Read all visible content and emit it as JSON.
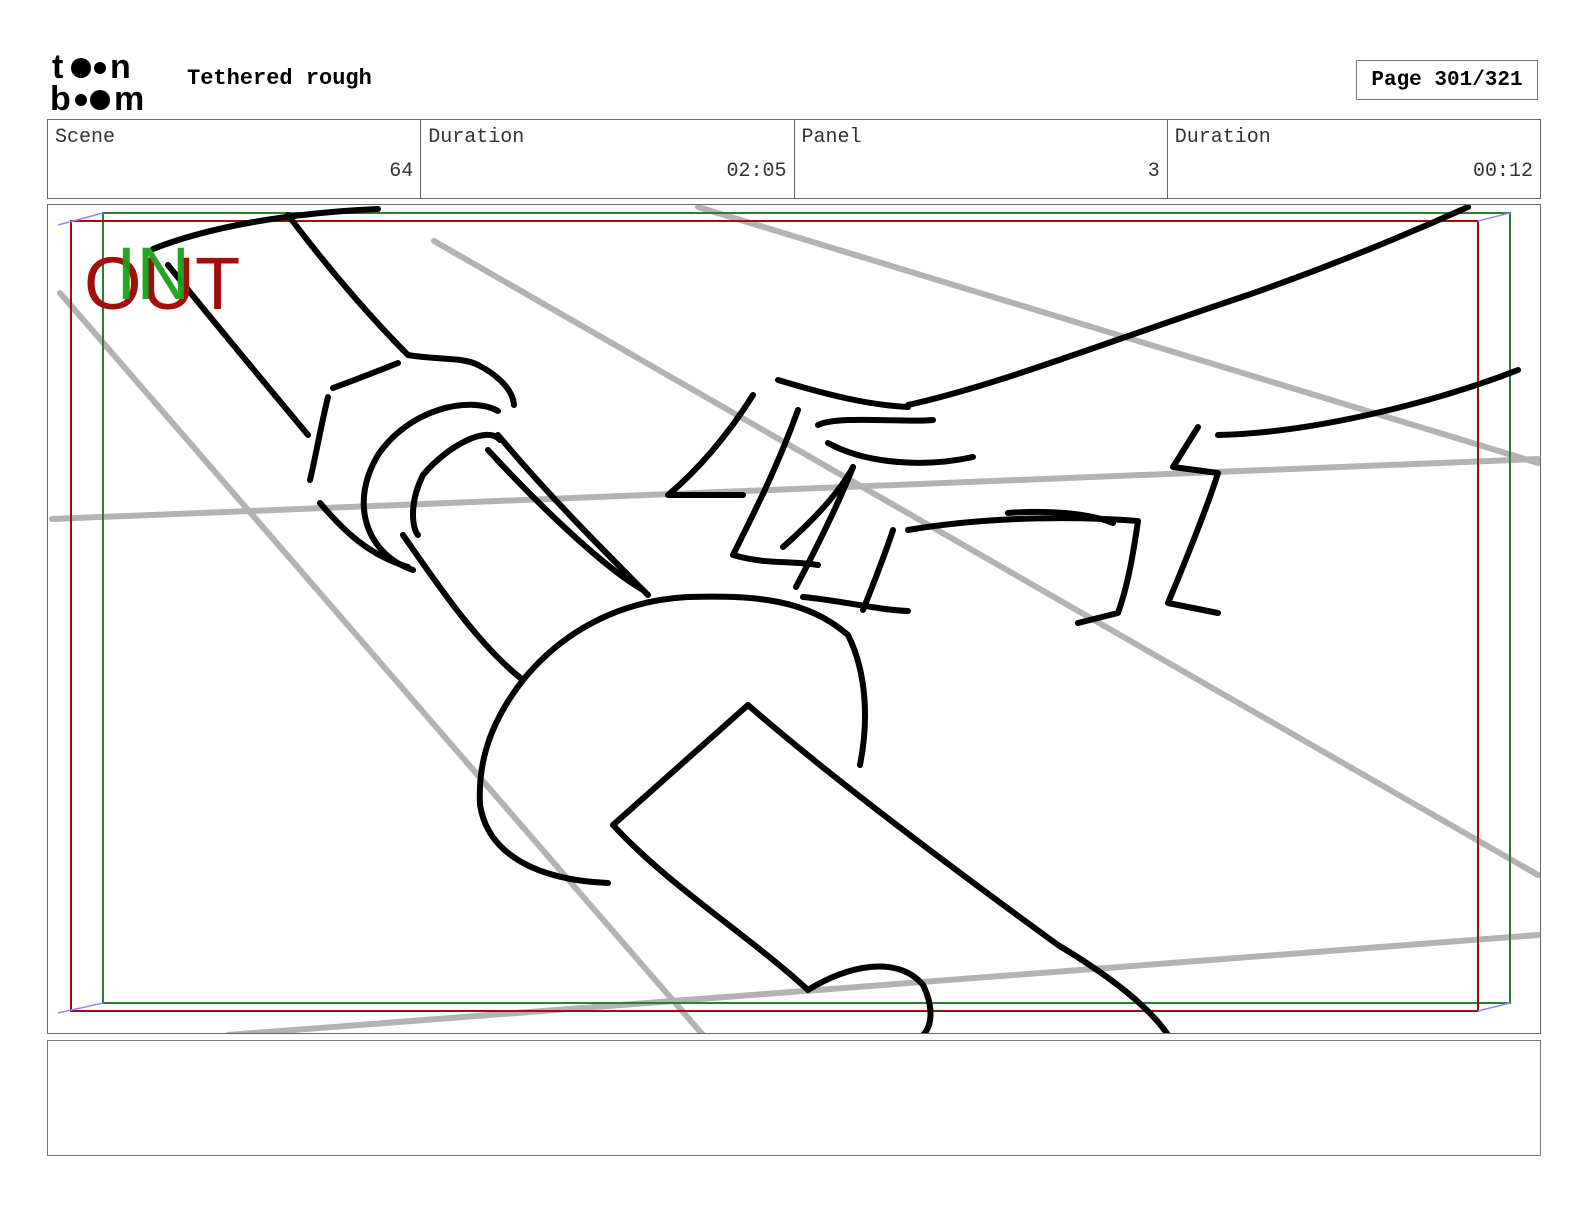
{
  "header": {
    "logo_text": "toon boom",
    "project_title": "Tethered rough",
    "page_label": "Page 301/321"
  },
  "info": {
    "scene_label": "Scene",
    "scene_value": "64",
    "scene_duration_label": "Duration",
    "scene_duration_value": "02:05",
    "panel_label": "Panel",
    "panel_value": "3",
    "panel_duration_label": "Duration",
    "panel_duration_value": "00:12"
  },
  "panel": {
    "in_label": "IN",
    "out_label": "OUT",
    "in_color": "#1aa31a",
    "out_color": "#a30d0d",
    "guide_color": "#b3b3b3",
    "sketch_color": "#000000"
  },
  "notes": {
    "text": ""
  }
}
